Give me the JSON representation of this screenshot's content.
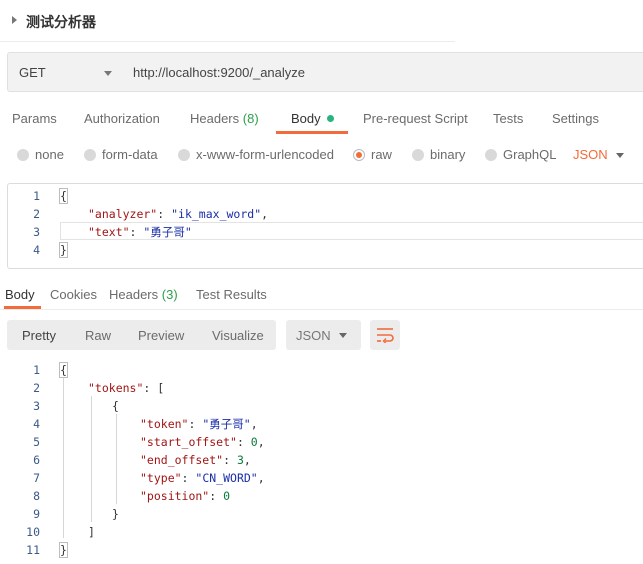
{
  "header": {
    "title": "测试分析器"
  },
  "request": {
    "method": "GET",
    "url": "http://localhost:9200/_analyze"
  },
  "request_tabs": [
    {
      "label": "Params"
    },
    {
      "label": "Authorization"
    },
    {
      "label": "Headers",
      "count": "(8)"
    },
    {
      "label": "Body"
    },
    {
      "label": "Pre-request Script"
    },
    {
      "label": "Tests"
    },
    {
      "label": "Settings"
    }
  ],
  "body_types": [
    {
      "label": "none"
    },
    {
      "label": "form-data"
    },
    {
      "label": "x-www-form-urlencoded"
    },
    {
      "label": "raw"
    },
    {
      "label": "binary"
    },
    {
      "label": "GraphQL"
    }
  ],
  "body_format": "JSON",
  "request_body": {
    "line_numbers": [
      "1",
      "2",
      "3",
      "4"
    ],
    "open_brace": "{",
    "close_brace": "}",
    "analyzer_key": "\"analyzer\"",
    "analyzer_value": "\"ik_max_word\"",
    "text_key": "\"text\"",
    "text_value": "\"勇子哥\""
  },
  "response_tabs": [
    {
      "label": "Body"
    },
    {
      "label": "Cookies"
    },
    {
      "label": "Headers",
      "count": "(3)"
    },
    {
      "label": "Test Results"
    }
  ],
  "response_views": [
    "Pretty",
    "Raw",
    "Preview",
    "Visualize"
  ],
  "response_format": "JSON",
  "response_body": {
    "line_numbers": [
      "1",
      "2",
      "3",
      "4",
      "5",
      "6",
      "7",
      "8",
      "9",
      "10",
      "11"
    ],
    "open_brace": "{",
    "close_brace": "}",
    "tokens_key": "\"tokens\"",
    "open_bracket": "[",
    "close_bracket": "]",
    "token_key": "\"token\"",
    "token_value": "\"勇子哥\"",
    "start_offset_key": "\"start_offset\"",
    "start_offset_value": "0",
    "end_offset_key": "\"end_offset\"",
    "end_offset_value": "3",
    "type_key": "\"type\"",
    "type_value": "\"CN_WORD\"",
    "position_key": "\"position\"",
    "position_value": "0"
  },
  "colors": {
    "accent": "#f26b3a",
    "active_dot": "#26b47f",
    "count": "#2d9f4b",
    "json_key": "#a31515",
    "json_string": "#1a2ea8",
    "json_number": "#0a7a3a"
  },
  "icons": {
    "wrap": "wrap-lines-icon",
    "caret": "chevron-down-icon",
    "title_caret": "caret-right-icon"
  }
}
